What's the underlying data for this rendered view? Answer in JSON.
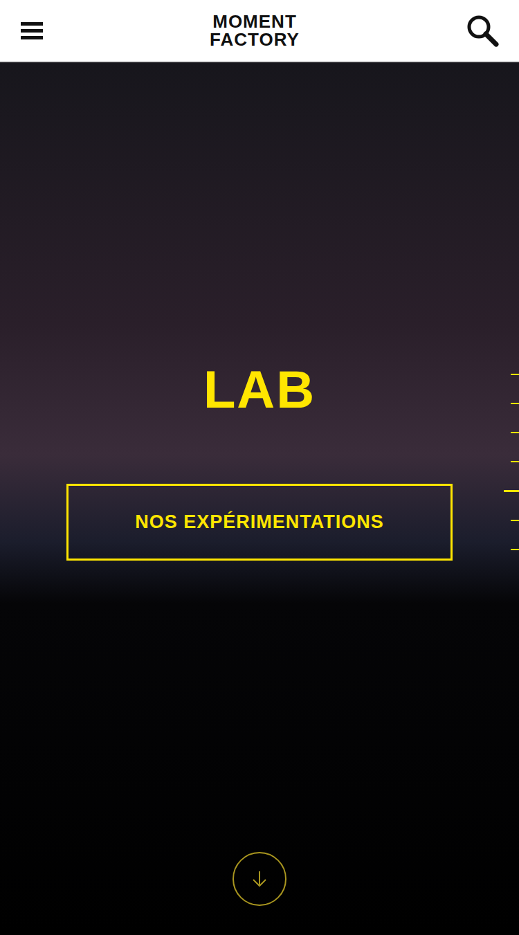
{
  "header": {
    "logo": [
      "MOMENT",
      "FACTORY"
    ]
  },
  "hero": {
    "title": "LAB",
    "button": "NOS EXPÉRIMENTATIONS"
  },
  "section_nav": [
    {
      "selected": false
    },
    {
      "selected": false
    },
    {
      "selected": false
    },
    {
      "selected": false
    },
    {
      "selected": true
    },
    {
      "selected": false
    },
    {
      "selected": false
    }
  ]
}
